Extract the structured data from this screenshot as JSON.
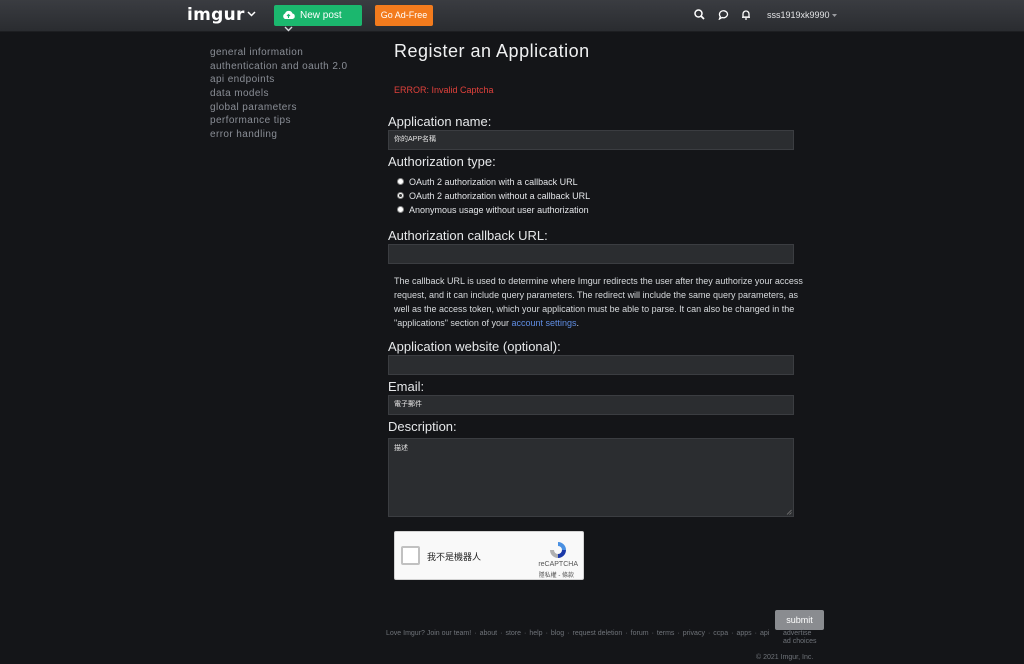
{
  "header": {
    "logo": "imgur",
    "new_post": "New post",
    "go_ad_free": "Go Ad-Free",
    "username": "sss1919xk9990",
    "icons": [
      "search-icon",
      "chat-icon",
      "bell-icon"
    ],
    "colors": {
      "new_post": "#1bb76e",
      "ad_free": "#f37b1d"
    }
  },
  "sidebar": {
    "items": [
      {
        "label": "general information"
      },
      {
        "label": "authentication and oauth 2.0"
      },
      {
        "label": "api endpoints"
      },
      {
        "label": "data models"
      },
      {
        "label": "global parameters"
      },
      {
        "label": "performance tips"
      },
      {
        "label": "error handling"
      }
    ]
  },
  "form": {
    "title": "Register an Application",
    "error": "ERROR: Invalid Captcha",
    "app_name_label": "Application name:",
    "app_name_value": "你的APP名稱",
    "auth_type_label": "Authorization type:",
    "auth_options": [
      {
        "label": "OAuth 2 authorization with a callback URL",
        "checked": false
      },
      {
        "label": "OAuth 2 authorization without a callback URL",
        "checked": true
      },
      {
        "label": "Anonymous usage without user authorization",
        "checked": false
      }
    ],
    "callback_label": "Authorization callback URL:",
    "callback_value": "",
    "help_text_before": "The callback URL is used to determine where Imgur redirects the user after they authorize your access request, and it can include query parameters. The redirect will include the same query parameters, as well as the access token, which your application must be able to parse. It can also be changed in the \"applications\" section of your ",
    "help_link": "account settings",
    "help_text_after": ".",
    "website_label": "Application website (optional):",
    "website_value": "",
    "email_label": "Email:",
    "email_value": "電子郵件",
    "description_label": "Description:",
    "description_value": "描述",
    "submit": "submit"
  },
  "captcha": {
    "label": "我不是機器人",
    "brand": "reCAPTCHA",
    "links": "隱私權 - 條款"
  },
  "footer": {
    "links": [
      "Love Imgur? Join our team!",
      "about",
      "store",
      "help",
      "blog",
      "request deletion",
      "forum",
      "terms",
      "privacy",
      "ccpa",
      "apps",
      "api"
    ],
    "advertise": "advertise",
    "ad_choices": "ad choices",
    "copyright": "© 2021 Imgur, Inc."
  }
}
